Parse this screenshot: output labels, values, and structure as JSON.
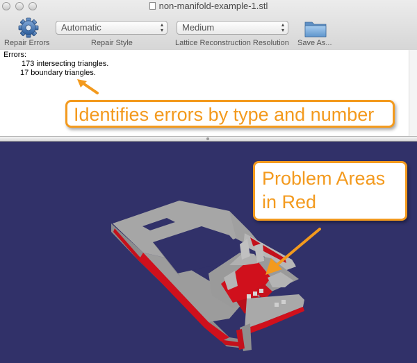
{
  "window": {
    "title": "non-manifold-example-1.stl"
  },
  "toolbar": {
    "repair_label": "Repair Errors",
    "repair_style_value": "Automatic",
    "repair_style_label": "Repair Style",
    "resolution_value": "Medium",
    "resolution_label": "Lattice Reconstruction Resolution",
    "save_label": "Save As..."
  },
  "errors": {
    "heading": "Errors:",
    "lines": [
      "173 intersecting triangles.",
      "17 boundary triangles."
    ]
  },
  "annotations": {
    "callout_top": "Identifies errors by type and number",
    "callout_view_line1": "Problem Areas",
    "callout_view_line2": "in Red"
  },
  "colors": {
    "accent": "#f39a1e",
    "viewport_bg": "#313169",
    "error_red": "#d0101c",
    "model_gray": "#9a9a9a"
  },
  "icons": [
    "gear-icon",
    "folder-icon",
    "document-icon"
  ]
}
